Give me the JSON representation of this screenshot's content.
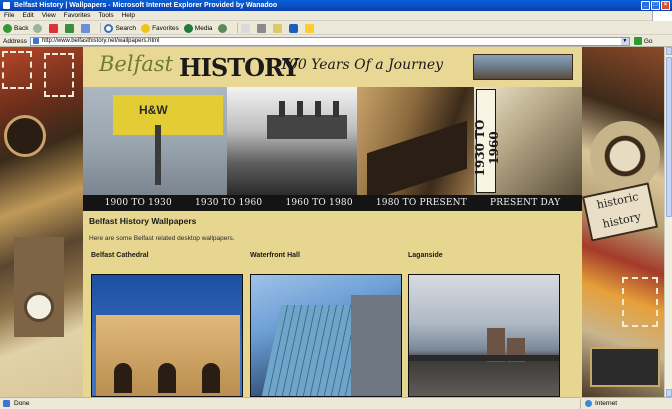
{
  "window": {
    "title": "Belfast History | Wallpapers - Microsoft Internet Explorer Provided by Wanadoo"
  },
  "menu": [
    "File",
    "Edit",
    "View",
    "Favorites",
    "Tools",
    "Help"
  ],
  "toolbar": {
    "back": "Back",
    "search": "Search",
    "favorites": "Favorites",
    "media": "Media"
  },
  "address": {
    "label": "Address",
    "url": "http://www.belfasthistory.net/wallpapers.html",
    "go": "Go"
  },
  "site": {
    "logo_belfast": "Belfast",
    "logo_history": "HISTORY",
    "logo_tagline": "100 Years Of a Journey",
    "strip_hw_text": "H&W",
    "strip_vertical": "1930 TO 1960",
    "nav": [
      "1900 TO 1930",
      "1930 TO 1960",
      "1960 TO 1980",
      "1980 TO PRESENT",
      "PRESENT DAY"
    ],
    "right_badge": "historic history"
  },
  "page": {
    "title": "Belfast History Wallpapers",
    "intro": "Here are some Belfast related desktop wallpapers.",
    "wallpapers": [
      {
        "label": "Belfast Cathedral"
      },
      {
        "label": "Waterfront Hall"
      },
      {
        "label": "Laganside"
      }
    ]
  },
  "status": {
    "left": "Done",
    "zone": "Internet"
  }
}
